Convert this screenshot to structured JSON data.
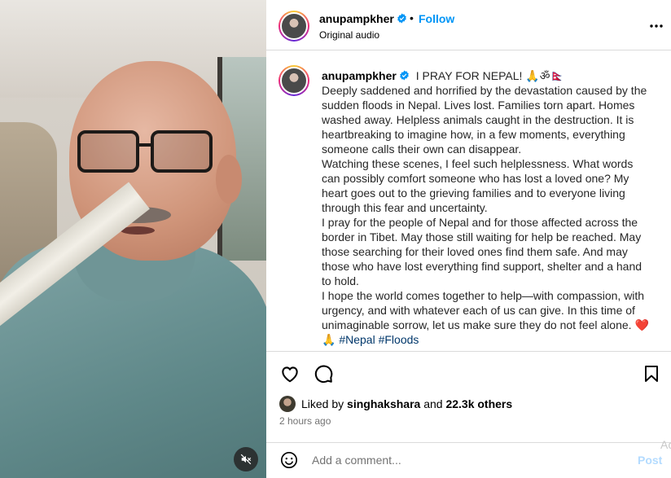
{
  "header": {
    "username": "anupampkher",
    "separator": "•",
    "follow_label": "Follow",
    "audio_label": "Original audio",
    "more_icon": "more-options-icon"
  },
  "caption": {
    "username": "anupampkher",
    "title": "I PRAY FOR NEPAL! 🙏ॐ🇳🇵",
    "paragraphs": [
      "Deeply saddened and horrified by the devastation caused by the sudden floods in Nepal. Lives lost. Families torn apart. Homes washed away. Helpless animals caught in the destruction. It is heartbreaking to imagine how, in a few moments, everything someone calls their own can disappear.",
      "Watching these scenes, I feel such helplessness. What words can possibly comfort someone who has lost a loved one? My heart goes out to the grieving families and to everyone living through this fear and uncertainty.",
      "I pray for the people of Nepal and for those affected across the border in Tibet. May those still waiting for help be reached. May those searching for their loved ones find them safe. And may those who have lost everything find support, shelter and a hand to hold.",
      "I hope the world comes together to help—with compassion, with urgency, and with whatever each of us can give. In this time of unimaginable sorrow, let us make sure they do not feel alone. ❤️"
    ],
    "closing_emoji": "🙏",
    "hashtags": [
      "#Nepal",
      "#Floods"
    ]
  },
  "likes": {
    "prefix": "Liked by",
    "user": "singhakshara",
    "middle": "and",
    "count": "22.3k others"
  },
  "time_ago": "2 hours ago",
  "comment": {
    "placeholder": "Add a comment...",
    "post_label": "Post",
    "overflow_text": "Ac"
  },
  "colors": {
    "accent": "#0095f6",
    "hashtag": "#00376b",
    "heart": "#ed1c24",
    "post_disabled": "#b3dbff"
  }
}
